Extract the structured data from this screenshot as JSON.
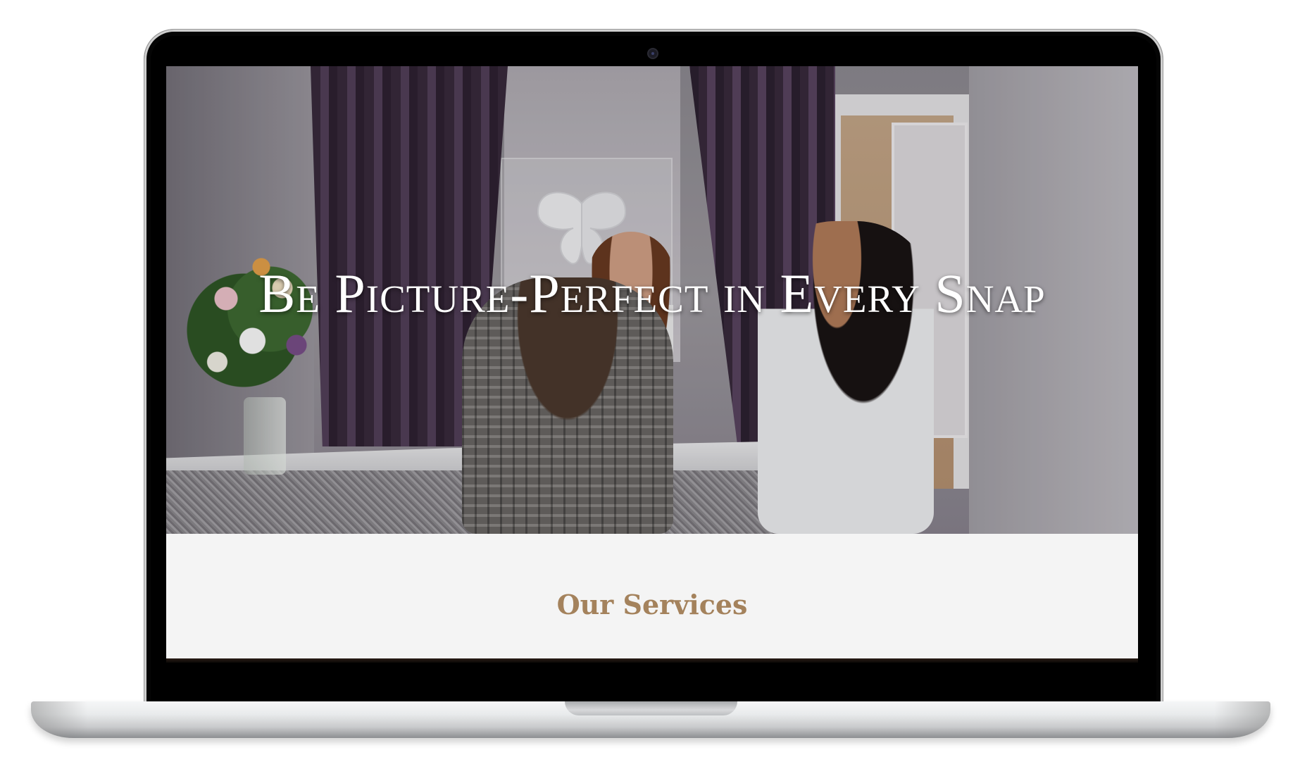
{
  "hero": {
    "title": "Be Picture-Perfect in Every Snap"
  },
  "services": {
    "title": "Our Services"
  },
  "colors": {
    "services_title": "#a4825c",
    "page_background": "#f4f4f4",
    "hero_title": "#ffffff"
  },
  "icons": {
    "butterfly_logo": "butterfly-logo-icon",
    "camera": "webcam-icon"
  }
}
